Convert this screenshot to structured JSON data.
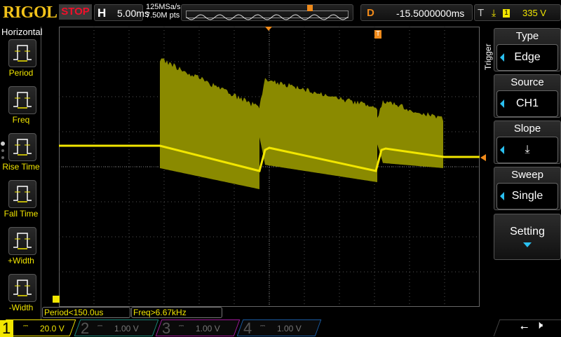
{
  "header": {
    "logo": "RIGOL",
    "run_state": "STOP",
    "h_label": "H",
    "timebase": "5.00ms",
    "sample_rate": "125MSa/s",
    "memory_depth": "7.50M pts",
    "delay_label": "D",
    "delay": "-15.5000000ms",
    "trig_label": "T",
    "trig_source": "1",
    "trig_level": "335 V"
  },
  "left_menu": {
    "title": "Horizontal",
    "items": [
      {
        "label": "Period",
        "icon": "period-icon"
      },
      {
        "label": "Freq",
        "icon": "freq-icon"
      },
      {
        "label": "Rise Time",
        "icon": "rise-time-icon"
      },
      {
        "label": "Fall Time",
        "icon": "fall-time-icon"
      },
      {
        "label": "+Width",
        "icon": "pos-width-icon"
      },
      {
        "label": "-Width",
        "icon": "neg-width-icon"
      }
    ]
  },
  "trigger_menu": {
    "title": "Trigger",
    "items": [
      {
        "label": "Type",
        "value": "Edge"
      },
      {
        "label": "Source",
        "value": "CH1"
      },
      {
        "label": "Slope",
        "value": "falling-edge-icon"
      },
      {
        "label": "Sweep",
        "value": "Single"
      }
    ],
    "setting": "Setting"
  },
  "measurements": [
    "Period<150.0us",
    "Freq>6.67kHz"
  ],
  "channels": [
    {
      "n": "1",
      "scale": "20.0 V",
      "color": "#f2e600",
      "active": true
    },
    {
      "n": "2",
      "scale": "1.00 V",
      "color": "#1a8a7a"
    },
    {
      "n": "3",
      "scale": "1.00 V",
      "color": "#a01a9a"
    },
    {
      "n": "4",
      "scale": "1.00 V",
      "color": "#1a5aa0"
    }
  ],
  "colors": {
    "ch1": "#f2e600",
    "trigger": "#f08a1a",
    "accent": "#2ac0f0",
    "stop": "#f0102a"
  }
}
